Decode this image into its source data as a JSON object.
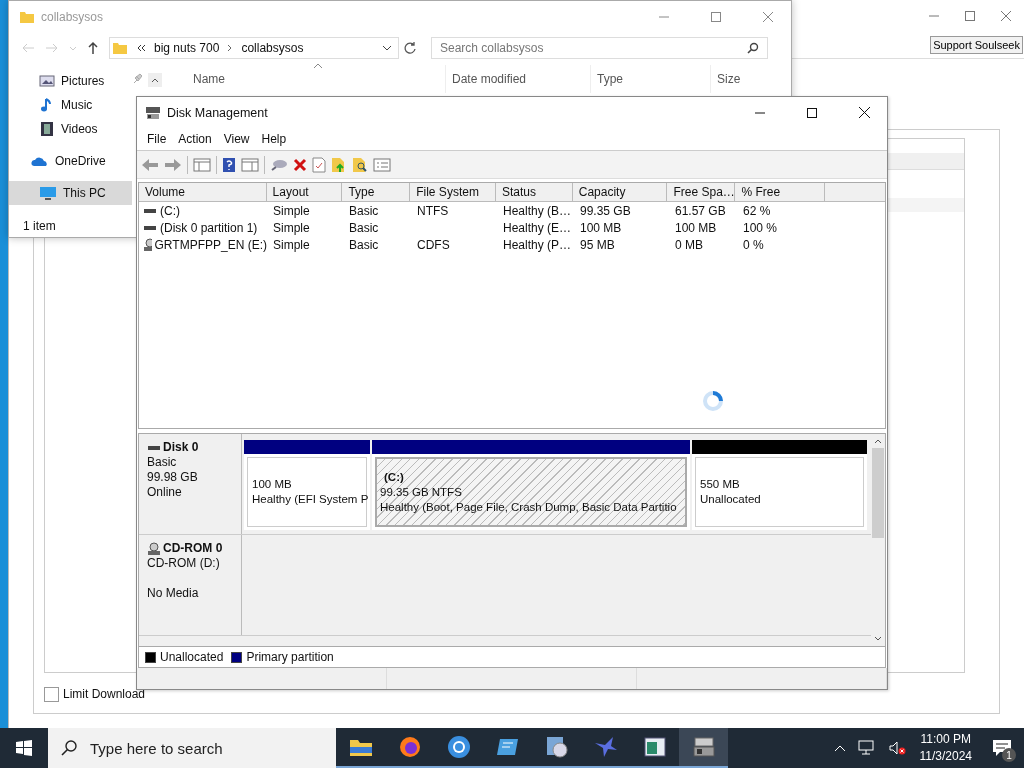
{
  "soulseek_window": {
    "support_button": "Support Soulseek",
    "limit_download": {
      "label": "Limit Download",
      "checked": false
    }
  },
  "explorer_window": {
    "title": "collabsysos",
    "address": [
      "big nuts 700",
      "collabsysos"
    ],
    "search": {
      "placeholder": "Search collabsysos"
    },
    "nav_items": [
      {
        "label": "Pictures",
        "kind": "pictures",
        "selected": false
      },
      {
        "label": "Music",
        "kind": "music",
        "selected": false
      },
      {
        "label": "Videos",
        "kind": "videos",
        "selected": false
      },
      {
        "label": "OneDrive",
        "kind": "cloud",
        "selected": false
      },
      {
        "label": "This PC",
        "kind": "pc",
        "selected": true
      }
    ],
    "columns": [
      "Name",
      "Date modified",
      "Type",
      "Size"
    ],
    "status_bar": "1 item"
  },
  "disk_management": {
    "title": "Disk Management",
    "menu": [
      "File",
      "Action",
      "View",
      "Help"
    ],
    "columns": [
      "Volume",
      "Layout",
      "Type",
      "File System",
      "Status",
      "Capacity",
      "Free Spa…",
      "% Free"
    ],
    "volumes": [
      {
        "kind": "disk",
        "volume": "(C:)",
        "layout": "Simple",
        "type": "Basic",
        "file_system": "NTFS",
        "status": "Healthy (B…",
        "capacity": "99.35 GB",
        "free_space": "61.57 GB",
        "percent_free": "62 %"
      },
      {
        "kind": "disk",
        "volume": "(Disk 0 partition 1)",
        "layout": "Simple",
        "type": "Basic",
        "status": "Healthy (E…",
        "capacity": "100 MB",
        "free_space": "100 MB",
        "percent_free": "100 %"
      },
      {
        "kind": "cdrom",
        "volume": "GRTMPFPP_EN (E:)",
        "layout": "Simple",
        "type": "Basic",
        "file_system": "CDFS",
        "status": "Healthy (P…",
        "capacity": "95 MB",
        "free_space": "0 MB",
        "percent_free": "0 %"
      }
    ],
    "disks": [
      {
        "kind": "disk",
        "name": "Disk 0",
        "details": [
          "Basic",
          "99.98 GB",
          "Online"
        ],
        "partitions": [
          {
            "color": "#000080",
            "lines": [
              "100 MB",
              "Healthy (EFI System P"
            ],
            "selected": false
          },
          {
            "color": "#000080",
            "name": "(C:)",
            "lines": [
              "99.35 GB NTFS",
              "Healthy (Boot, Page File, Crash Dump, Basic Data Partitio"
            ],
            "selected": true
          },
          {
            "color": "#000000",
            "lines": [
              "550 MB",
              "Unallocated"
            ],
            "selected": false
          }
        ]
      },
      {
        "kind": "cdrom",
        "name": "CD-ROM 0",
        "details": [
          "CD-ROM (D:)"
        ],
        "media": "No Media"
      }
    ],
    "legend": [
      {
        "label": "Unallocated",
        "color": "#000000"
      },
      {
        "label": "Primary partition",
        "color": "#000080"
      }
    ]
  },
  "taskbar": {
    "search": {
      "placeholder": "Type here to search"
    },
    "apps": [
      {
        "kind": "folder",
        "active": false
      },
      {
        "kind": "firefox",
        "active": false
      },
      {
        "kind": "chrome",
        "active": false
      },
      {
        "kind": "remote",
        "active": false
      },
      {
        "kind": "media",
        "active": false
      },
      {
        "kind": "bird",
        "active": false
      },
      {
        "kind": "window",
        "active": false
      },
      {
        "kind": "disks",
        "active": true
      }
    ],
    "time": "11:00 PM",
    "date": "11/3/2024",
    "notifications": "1"
  }
}
